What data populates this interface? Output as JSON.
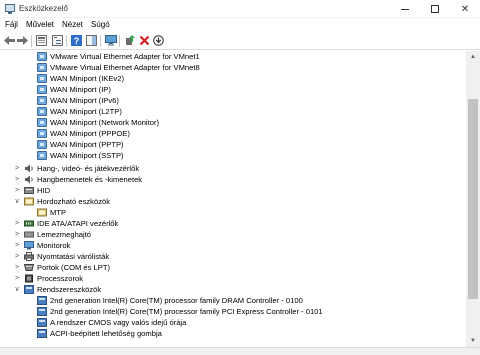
{
  "window": {
    "title": "Eszközkezelő"
  },
  "menu": [
    "Fájl",
    "Művelet",
    "Nézet",
    "Súgó"
  ],
  "toolbar": {
    "buttons": [
      "back-icon",
      "forward-icon",
      "properties-icon",
      "tree-view-icon",
      "help-icon",
      "action-view-icon",
      "monitor-icon",
      "update-driver-icon",
      "uninstall-icon",
      "download-icon"
    ]
  },
  "tree": {
    "items": [
      {
        "label": "VMware Virtual Ethernet Adapter for VMnet1",
        "icon": "network-adapter-icon"
      },
      {
        "label": "VMware Virtual Ethernet Adapter for VMnet8",
        "icon": "network-adapter-icon"
      },
      {
        "label": "WAN Miniport (IKEv2)",
        "icon": "network-adapter-icon"
      },
      {
        "label": "WAN Miniport (IP)",
        "icon": "network-adapter-icon"
      },
      {
        "label": "WAN Miniport (IPv6)",
        "icon": "network-adapter-icon"
      },
      {
        "label": "WAN Miniport (L2TP)",
        "icon": "network-adapter-icon"
      },
      {
        "label": "WAN Miniport (Network Monitor)",
        "icon": "network-adapter-icon"
      },
      {
        "label": "WAN Miniport (PPPOE)",
        "icon": "network-adapter-icon"
      },
      {
        "label": "WAN Miniport (PPTP)",
        "icon": "network-adapter-icon"
      },
      {
        "label": "WAN Miniport (SSTP)",
        "icon": "network-adapter-icon"
      },
      {
        "label": "Hang-, videó- és játékvezérlők",
        "icon": "speaker-icon"
      },
      {
        "label": "Hangbemenetek és -kimenetek",
        "icon": "speaker-icon"
      },
      {
        "label": "HID",
        "icon": "hid-icon"
      },
      {
        "label": "Hordozható eszközök",
        "icon": "portable-device-icon"
      },
      {
        "label": "MTP",
        "icon": "portable-device-icon"
      },
      {
        "label": "IDE ATA/ATAPI vezérlők",
        "icon": "ide-controller-icon"
      },
      {
        "label": "Lemezmeghajtó",
        "icon": "disk-drive-icon"
      },
      {
        "label": "Monitorok",
        "icon": "monitor-icon"
      },
      {
        "label": "Nyomtatási várólisták",
        "icon": "printer-icon"
      },
      {
        "label": "Portok (COM és LPT)",
        "icon": "port-icon"
      },
      {
        "label": "Processzorok",
        "icon": "processor-icon"
      },
      {
        "label": "Rendszereszközök",
        "icon": "system-device-icon"
      },
      {
        "label": "2nd generation Intel(R) Core(TM) processor family DRAM Controller - 0100",
        "icon": "system-device-icon"
      },
      {
        "label": "2nd generation Intel(R) Core(TM) processor family PCI Express Controller - 0101",
        "icon": "system-device-icon"
      },
      {
        "label": "A rendszer CMOS vagy valós idejű órája",
        "icon": "system-device-icon"
      },
      {
        "label": "ACPI-beépített lehetőség gombja",
        "icon": "system-device-icon"
      }
    ]
  }
}
